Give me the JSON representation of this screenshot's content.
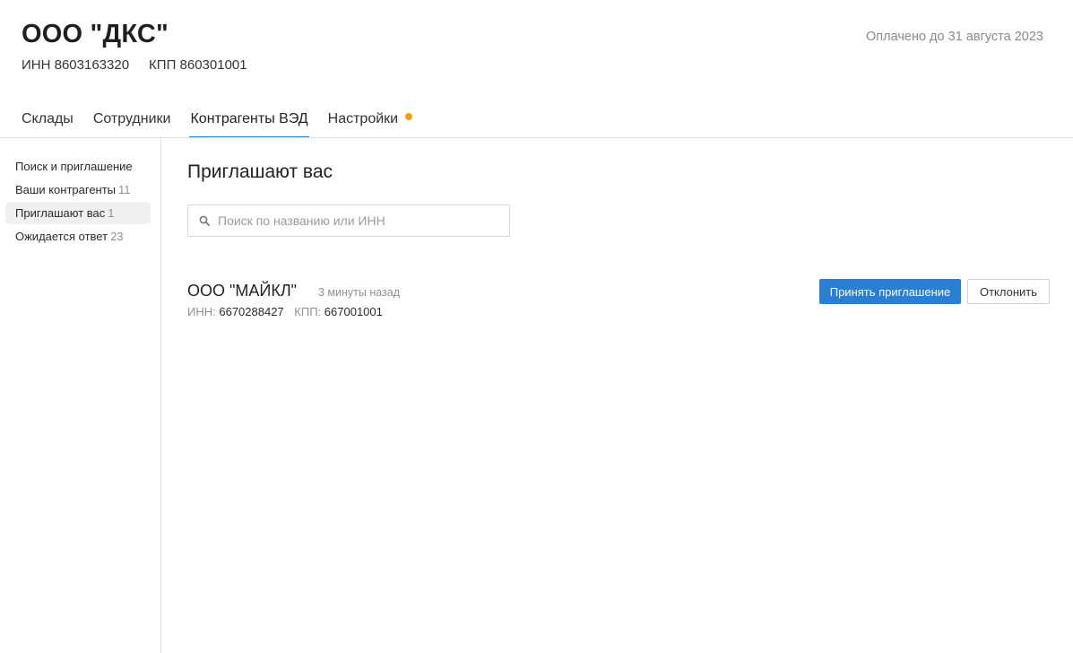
{
  "header": {
    "company_name": "ООО \"ДКС\"",
    "inn": "ИНН 8603163320",
    "kpp": "КПП 860301001",
    "paid_until": "Оплачено до 31 августа 2023"
  },
  "tabs": [
    {
      "label": "Склады",
      "active": false
    },
    {
      "label": "Сотрудники",
      "active": false
    },
    {
      "label": "Контрагенты ВЭД",
      "active": true
    },
    {
      "label": "Настройки",
      "active": false,
      "notification_dot": true
    }
  ],
  "sidebar": {
    "items": [
      {
        "label": "Поиск и приглашение",
        "count": ""
      },
      {
        "label": "Ваши контрагенты",
        "count": "11"
      },
      {
        "label": "Приглашают вас",
        "count": "1",
        "active": true
      },
      {
        "label": "Ожидается ответ",
        "count": "23"
      }
    ]
  },
  "main": {
    "title": "Приглашают вас",
    "search": {
      "value": "",
      "placeholder": "Поиск по названию или ИНН"
    },
    "invites": [
      {
        "name": "ООО \"МАЙКЛ\"",
        "time": "3 минуты назад",
        "inn_label": "ИНН:",
        "inn": "6670288427",
        "kpp_label": "КПП:",
        "kpp": "667001001",
        "accept_label": "Принять приглашение",
        "decline_label": "Отклонить"
      }
    ]
  },
  "colors": {
    "accent": "#2a7fd2",
    "tab_underline": "#2c7fd4",
    "notification_dot": "#f0a30a",
    "muted_text": "#8f8f8f"
  }
}
